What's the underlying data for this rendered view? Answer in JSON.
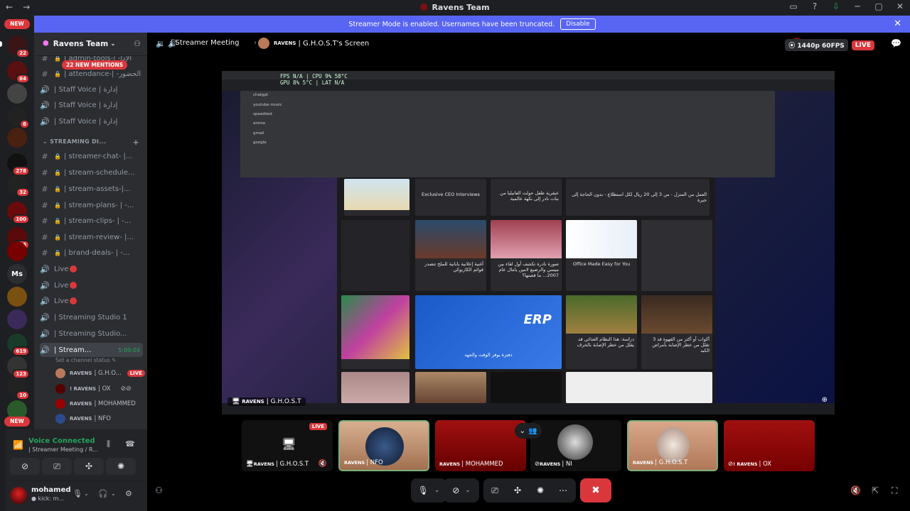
{
  "window": {
    "title": "Ravens Team",
    "back_icon": "←",
    "forward_icon": "→",
    "controls": [
      "▭",
      "?",
      "⇩",
      "─",
      "▢",
      "✕"
    ]
  },
  "banner": {
    "text": "Streamer Mode is enabled. Usernames have been truncated.",
    "disable": "Disable"
  },
  "server": {
    "name": "Ravens Team",
    "new_mentions": "22 NEW MENTIONS"
  },
  "guilds": [
    {
      "label": "NEW",
      "badge": ""
    },
    {
      "label": "",
      "badge": "22"
    },
    {
      "label": "",
      "badge": "64"
    },
    {
      "label": "",
      "badge": ""
    },
    {
      "label": "",
      "badge": "6"
    },
    {
      "label": "",
      "badge": ""
    },
    {
      "label": "",
      "badge": "278"
    },
    {
      "label": "",
      "badge": "32"
    },
    {
      "label": "",
      "badge": "100"
    },
    {
      "label": "",
      "badge": "116"
    },
    {
      "label": "",
      "badge": ""
    },
    {
      "label": "Ms",
      "badge": ""
    },
    {
      "label": "",
      "badge": ""
    },
    {
      "label": "",
      "badge": ""
    },
    {
      "label": "",
      "badge": "619"
    },
    {
      "label": "",
      "badge": "123"
    },
    {
      "label": "",
      "badge": "10"
    },
    {
      "label": "",
      "badge": ""
    },
    {
      "label": "NEW",
      "badge": ""
    }
  ],
  "channels": [
    {
      "icon": "#",
      "lock": true,
      "name": "| admin-tools-| -الإدا"
    },
    {
      "icon": "#",
      "lock": true,
      "name": "| attendance-| -الحضور"
    },
    {
      "icon": "🔊",
      "lock": false,
      "name": "| Staff Voice | إدارة"
    },
    {
      "icon": "🔊",
      "lock": false,
      "name": "| Staff Voice | إدارة"
    },
    {
      "icon": "🔊",
      "lock": false,
      "name": "| Staff Voice | إدارة"
    }
  ],
  "category": {
    "name": "STREAMING DI...",
    "plus": "+"
  },
  "stream_channels": [
    {
      "icon": "#",
      "lock": true,
      "name": "| streamer-chat- |..."
    },
    {
      "icon": "#",
      "lock": true,
      "name": "| stream-schedule..."
    },
    {
      "icon": "#",
      "lock": true,
      "name": "| stream-assets-|..."
    },
    {
      "icon": "#",
      "lock": true,
      "name": "| stream-plans- | -..."
    },
    {
      "icon": "#",
      "lock": true,
      "name": "| stream-clips- | -..."
    },
    {
      "icon": "#",
      "lock": true,
      "name": "| stream-review- |..."
    },
    {
      "icon": "#",
      "lock": true,
      "name": "| brand-deals- | -..."
    },
    {
      "icon": "🔊",
      "lock": false,
      "name": "Live"
    },
    {
      "icon": "🔊",
      "lock": false,
      "name": "Live"
    },
    {
      "icon": "🔊",
      "lock": false,
      "name": "Live"
    },
    {
      "icon": "🔊",
      "lock": false,
      "name": "| Streaming Studio 1"
    },
    {
      "icon": "🔊",
      "lock": false,
      "name": "| Streaming Studio..."
    }
  ],
  "active_channel": {
    "name": "| Stream...",
    "timer": "5:09:04",
    "status_hint": "Set a channel status ✎"
  },
  "voice_users": [
    {
      "tag": "RAVENS",
      "name": "| G.H.O...",
      "live": "LIVE"
    },
    {
      "tag": "! RAVENS",
      "name": "| OX",
      "live": ""
    },
    {
      "tag": "RAVENS",
      "name": "| MOHAMMED",
      "live": ""
    },
    {
      "tag": "RAVENS",
      "name": "| NFO",
      "live": ""
    }
  ],
  "voice_connected": {
    "title": "Voice Connected",
    "sub": "| Streamer Meeting / R..."
  },
  "user": {
    "name": "mohamed",
    "status": "● kick: m..."
  },
  "call_header": {
    "channel": "| Streamer Meeting",
    "ghost_tag": "RAVENS",
    "ghost_name": "| G.H.O.S.T's Screen",
    "quality": "⦿ 1440p 60FPS",
    "live": "LIVE"
  },
  "stage": {
    "perf_line1": "FPS N/A  | CPU 9% 58°C",
    "perf_line2": "GPU 8% 5°C  | LAT N/A",
    "url_rows": [
      "chatgpt",
      "youtube music",
      "speedtest",
      "anime",
      "gmail",
      "google"
    ],
    "presenter_tag": "RAVENS",
    "presenter_name": "| G.H.O.S.T",
    "cards": [
      {
        "title": "",
        "en": false
      },
      {
        "title": "Exclusive CEO Interviews",
        "en": true
      },
      {
        "title": "عبقرية طفل حولت الفانيليا من نبات نادر إلى نكهة عالمية",
        "en": false
      },
      {
        "title": "العمل من المنزل - من 3 إلى 20 ريال لكل استطلاع - بدون الحاجة إلى خبرة",
        "en": false
      },
      {
        "title": "",
        "en": false
      },
      {
        "title": "أغنية إعلانية يابانية للملح تتصدر قوائم الكاريوكي",
        "en": false
      },
      {
        "title": "صورة نادرة تكشف أول لقاء بين ميسي والرضيع لامين يامال عام 2007... ما قصتها؟",
        "en": false
      },
      {
        "title": "Office Made Easy for You",
        "en": true
      },
      {
        "title": "",
        "en": false
      },
      {
        "title": "",
        "en": false
      },
      {
        "title": "دفترة يوفر الوقت والجهد",
        "en": false
      },
      {
        "title": "دراسة: هذا النظام الغذائي قد يقلل من خطر الإصابة بالخرف",
        "en": false
      },
      {
        "title": "3 أكواب أو أكثر من القهوة قد تقلل من خطر الإصابة بأمراض الكبد",
        "en": false
      }
    ]
  },
  "tiles": [
    {
      "tag": "RAVENS",
      "name": "| G.H.O.S.T",
      "live": "LIVE"
    },
    {
      "tag": "RAVENS",
      "name": "| NFO",
      "live": ""
    },
    {
      "tag": "RAVENS",
      "name": "| MOHAMMED",
      "live": ""
    },
    {
      "tag": "RAVENS",
      "name": "| NI",
      "live": ""
    },
    {
      "tag": "RAVENS",
      "name": "| G.H.O.S.T",
      "live": ""
    },
    {
      "tag": "! RAVENS",
      "name": "| OX",
      "live": ""
    }
  ],
  "colors": {
    "blurple": "#5865f2",
    "red": "#da373c",
    "green": "#23a55a",
    "bg": "#000000",
    "sidebar": "#2b2d31"
  }
}
